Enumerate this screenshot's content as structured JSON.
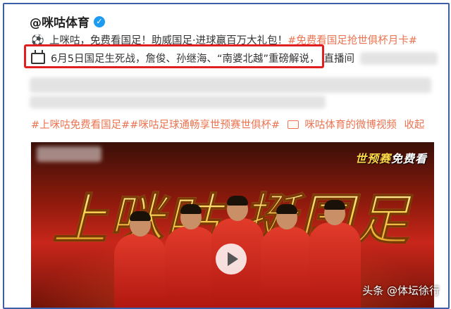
{
  "post": {
    "account": "@咪咕体育",
    "line1_text": "上咪咕，免费看国足！助威国足·进球赢百万大礼包！",
    "line1_link": "#免费看国足抢世俱杯月卡#",
    "line2_text": "6月5日国足生死战，詹俊、孙继海、“南婆北越”重磅解说，",
    "line2_tail": "直播间",
    "hashtags": "#上咪咕免费看国足##咪咕足球通畅享世预赛世俱杯#",
    "video_link": "咪咕体育的微博视频",
    "collapse": "收起"
  },
  "banner": {
    "tag_left": "世预赛",
    "tag_right": "免费看",
    "headline": "上咪咕 挺国足"
  },
  "watermark": "头条 @体坛徐行",
  "icons": {
    "verified": "verified-badge-icon",
    "soccer": "soccer-ball-icon",
    "tv": "tv-icon",
    "video": "video-icon",
    "play": "play-icon"
  },
  "colors": {
    "link": "#eb7350",
    "highlight": "#e02020",
    "frame": "#3d5fa7"
  }
}
